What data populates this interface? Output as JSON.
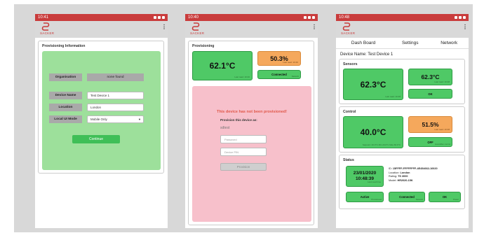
{
  "colors": {
    "brand_red": "#c93c3c",
    "green": "#4fc966",
    "orange": "#f5a85c",
    "pink": "#f7c0cb",
    "light_green": "#9de09b"
  },
  "screen1": {
    "status_time": "10:41",
    "brand": "SACKER",
    "card_title": "Provisioning Information",
    "organisation_label": "Organisation",
    "organisation_value": "none found",
    "device_name_label": "Device Name",
    "device_name_value": "Test Device 1",
    "location_label": "Location",
    "location_value": "London",
    "ui_mode_label": "Local UI Mode",
    "ui_mode_value": "Mobile Only",
    "continue_label": "Continue"
  },
  "screen2": {
    "status_time": "10:40",
    "brand": "SACKER",
    "card_title": "Provisioning",
    "temp_main": "62.1°C",
    "temp_main_sub": "Last read: 10:40",
    "humidity": "50.3%",
    "humidity_sub": "Last read: 10:40",
    "connected_label": "Connected",
    "connected_sub": "Network",
    "warning": "This device has not been provisioned!",
    "provision_as_label": "Provision this device as:",
    "username": "sdtest",
    "password_placeholder": "Password",
    "pin_placeholder": "Device PIN",
    "provision_button": "Provision"
  },
  "screen3": {
    "status_time": "10:48",
    "brand": "SACKER",
    "tabs": [
      "Dash Board",
      "Settings",
      "Network"
    ],
    "device_name": "Device Name: Test Device 1",
    "sensors_title": "Sensors",
    "sensor_temp": "62.3°C",
    "sensor_temp_sub": "Last read: 10:48",
    "sensor_small_temp": "62.3°C",
    "sensor_small_sub": "Last read: 10:48",
    "ok_label": "OK",
    "control_title": "Control",
    "control_temp": "40.0°C",
    "control_temp_sub": "Setpoint: 40.0°C Min 20.0°C Max 60.0°C",
    "control_pct": "51.5%",
    "control_pct_sub": "Last read: 10:48",
    "off_label": "OFF",
    "off_sub": "Humidifier control",
    "status_title": "Status",
    "date": "23/01/2020",
    "time": "10:48:39",
    "datetime_sub": "Last read time",
    "info_id": "ID:",
    "info_id_val": "15FFFF-FFFFFFFF-4E454662-10020",
    "info_location": "Location:",
    "info_location_val": "London",
    "info_rating": "Rating:",
    "info_rating_val": "TS 3000",
    "info_model": "Model:",
    "info_model_val": "HR2020-15K",
    "active_label": "Active",
    "active_sub": "Provisioned",
    "connected_label": "Connected",
    "connected_sub": "Network",
    "ok2_label": "OK",
    "ok2_sub": "Power"
  }
}
